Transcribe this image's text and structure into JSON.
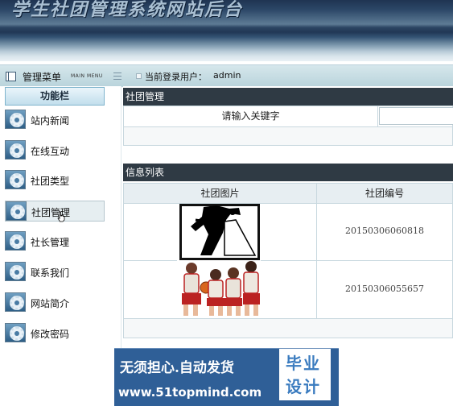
{
  "header": {
    "site_title": "学生社团管理系统网站后台"
  },
  "menubar": {
    "menu_label": "管理菜单",
    "menu_en": "MAIN MENU",
    "user_label": "当前登录用户：",
    "user_name": "admin"
  },
  "sidebar": {
    "title": "功能栏",
    "items": [
      {
        "label": "站内新闻",
        "icon": "gear-icon"
      },
      {
        "label": "在线互动",
        "icon": "gear-icon"
      },
      {
        "label": "社团类型",
        "icon": "gear-icon"
      },
      {
        "label": "社团管理",
        "icon": "gear-icon",
        "active": true
      },
      {
        "label": "社长管理",
        "icon": "gear-icon"
      },
      {
        "label": "联系我们",
        "icon": "gear-icon"
      },
      {
        "label": "网站简介",
        "icon": "gear-icon"
      },
      {
        "label": "修改密码",
        "icon": "gear-icon"
      }
    ]
  },
  "main": {
    "section_title": "社团管理",
    "search_label": "请输入关键字",
    "search_value": "",
    "list_title": "信息列表",
    "columns": [
      "社团图片",
      "社团编号"
    ],
    "rows": [
      {
        "image": "dancing-couple-image",
        "id": "20150306060818"
      },
      {
        "image": "basketball-team-image",
        "id": "20150306055657"
      }
    ]
  },
  "ad": {
    "line1": "无须担心.自动发货",
    "line2": "www.51topmind.com",
    "badge_line1": "毕业",
    "badge_line2": "设计"
  },
  "colors": {
    "header_dark": "#1f3452",
    "menubar": "#c8dfe6",
    "section_header": "#2f3a44",
    "ad_blue": "#2f5f97"
  }
}
